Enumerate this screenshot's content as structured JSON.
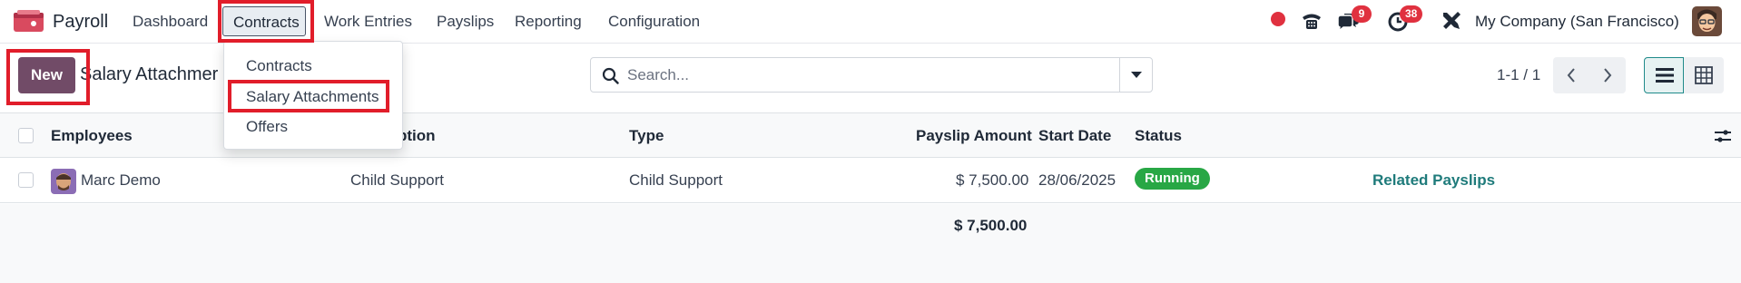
{
  "navbar": {
    "app_name": "Payroll",
    "menu": [
      "Dashboard",
      "Contracts",
      "Work Entries",
      "Payslips",
      "Reporting",
      "Configuration"
    ],
    "active_menu": "Contracts",
    "messages_badge": "9",
    "activities_badge": "38",
    "company": "My Company (San Francisco)",
    "icons": [
      "payroll-app-icon",
      "record-status-dot",
      "phone-icon",
      "chat-icon",
      "clock-icon",
      "tools-icon",
      "user-avatar"
    ]
  },
  "dropdown": {
    "items": [
      "Contracts",
      "Salary Attachments",
      "Offers"
    ],
    "highlighted": "Salary Attachments"
  },
  "control_panel": {
    "new_label": "New",
    "breadcrumb": "Salary Attachmer",
    "search_placeholder": "Search...",
    "pager": "1-1 / 1"
  },
  "table": {
    "headers": [
      "Employees",
      "ption",
      "Type",
      "Payslip Amount",
      "Start Date",
      "Status"
    ],
    "rows": [
      {
        "employee": "Marc Demo",
        "description": "Child Support",
        "type": "Child Support",
        "payslip_amount": "$ 7,500.00",
        "start_date": "28/06/2025",
        "status": "Running",
        "action": "Related Payslips"
      }
    ],
    "total": "$ 7,500.00"
  },
  "colors": {
    "primary": "#714b67",
    "highlight": "#e11d2a",
    "status_running": "#28a745",
    "badge": "#e0313f",
    "link": "#1f7b7b"
  }
}
